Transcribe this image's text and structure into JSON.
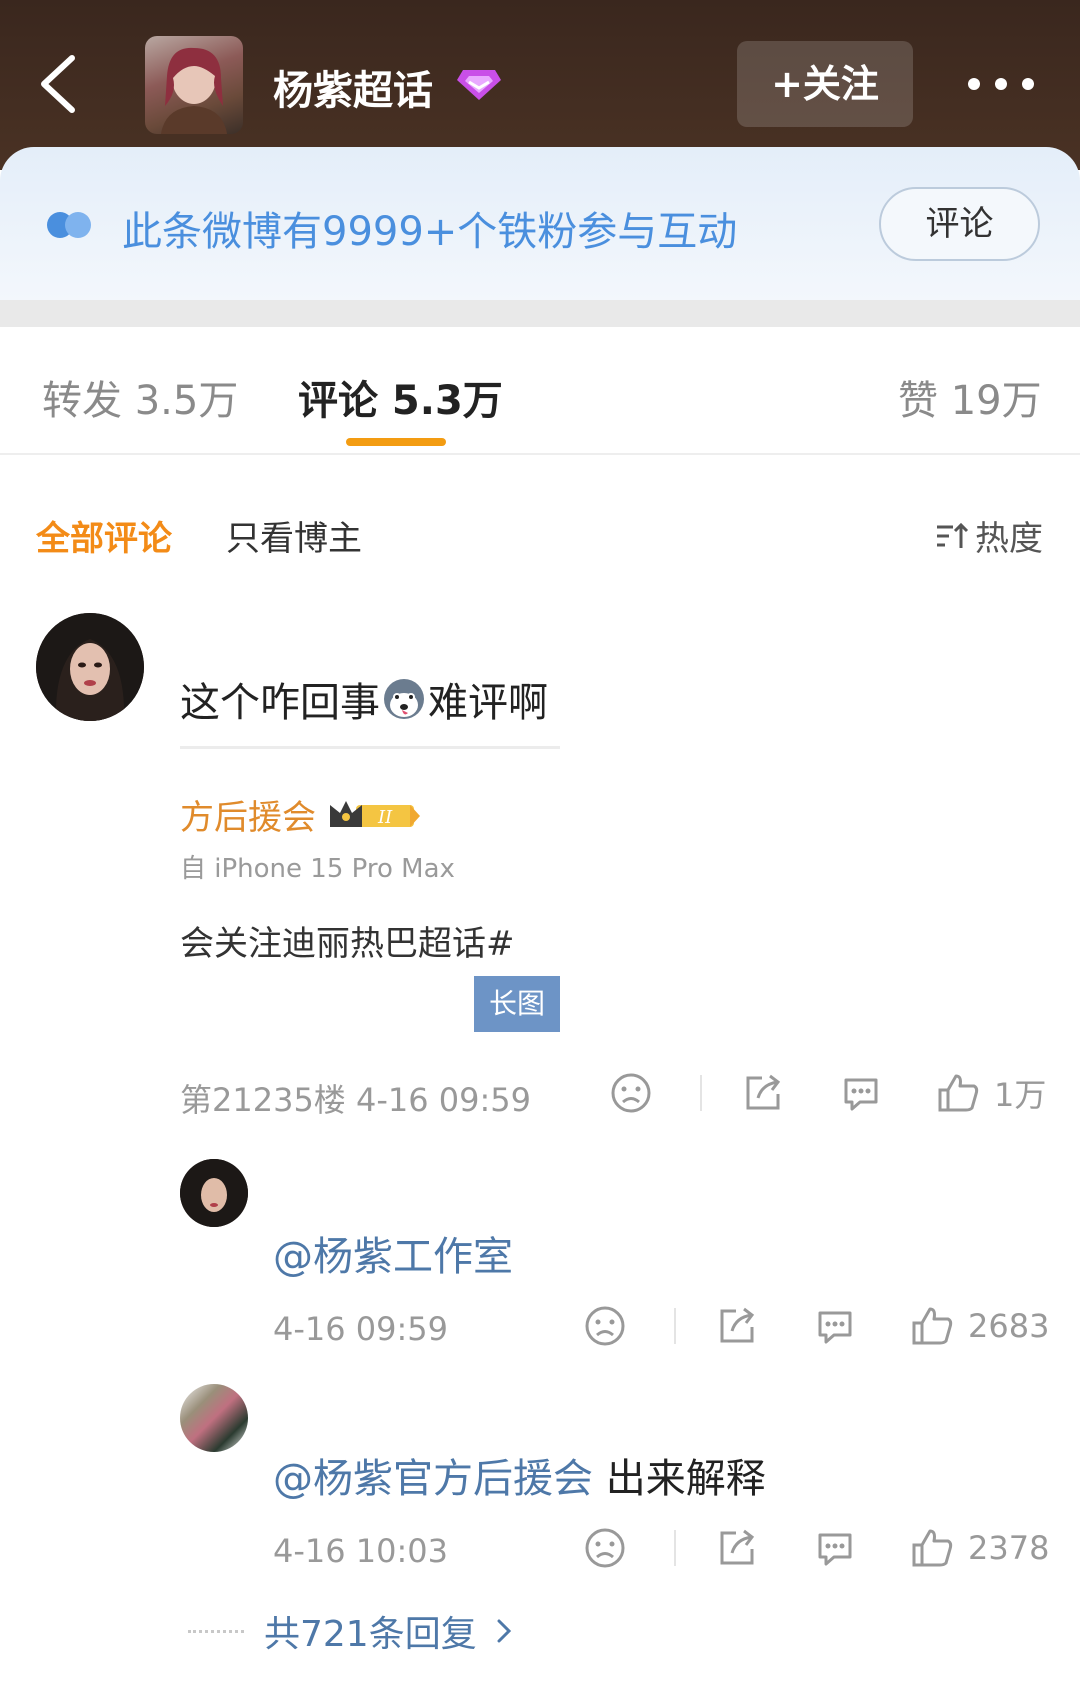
{
  "header": {
    "topic_title": "杨紫超话",
    "follow_label": "+关注"
  },
  "fan_banner": {
    "text": "此条微博有9999+个铁粉参与互动",
    "button_label": "评论"
  },
  "stats": {
    "repost": "转发 3.5万",
    "comment": "评论 5.3万",
    "like": "赞 19万"
  },
  "filters": {
    "all": "全部评论",
    "host_only": "只看博主",
    "sort": "热度"
  },
  "comment": {
    "text_before": "这个咋回事",
    "text_after": "难评啊",
    "image": {
      "name": "方后援会",
      "badge": "II",
      "device": "自 iPhone 15 Pro Max",
      "tag_text": "会关注迪丽热巴超话#",
      "long_image_label": "长图"
    },
    "floor_time": "第21235楼 4-16 09:59",
    "likes": "1万"
  },
  "replies": [
    {
      "mention": "@杨紫工作室",
      "text": "",
      "time": "4-16 09:59",
      "likes": "2683"
    },
    {
      "mention": "@杨紫官方后援会",
      "text": " 出来解释",
      "time": "4-16 10:03",
      "likes": "2378"
    }
  ],
  "more_replies": "共721条回复",
  "colors": {
    "accent_orange": "#f39c12",
    "link_blue": "#4e78a8",
    "fan_blue": "#4a8fde"
  }
}
